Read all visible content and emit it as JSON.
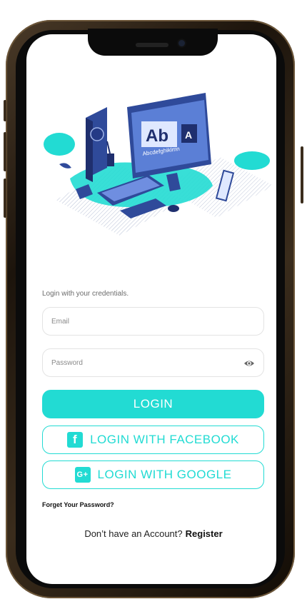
{
  "form": {
    "hint": "Login with your credentials.",
    "email_placeholder": "Email",
    "password_placeholder": "Password"
  },
  "buttons": {
    "login": "LOGIN",
    "facebook": "LOGIN WITH FACEBOOK",
    "google": "LOGIN WITH GOOGLE"
  },
  "links": {
    "forgot": "Forget Your Password?",
    "no_account": "Don’t have an Account?",
    "register": "Register"
  },
  "illustration": {
    "monitor_large_text": "Ab",
    "monitor_small_text": "A",
    "monitor_caption": "Abcdefghiklmn"
  },
  "colors": {
    "accent": "#22dbd3",
    "illustration_blue": "#2f4a9a"
  },
  "icons": {
    "password_visibility": "eye-icon",
    "facebook": "facebook-icon",
    "google": "google-plus-icon"
  }
}
